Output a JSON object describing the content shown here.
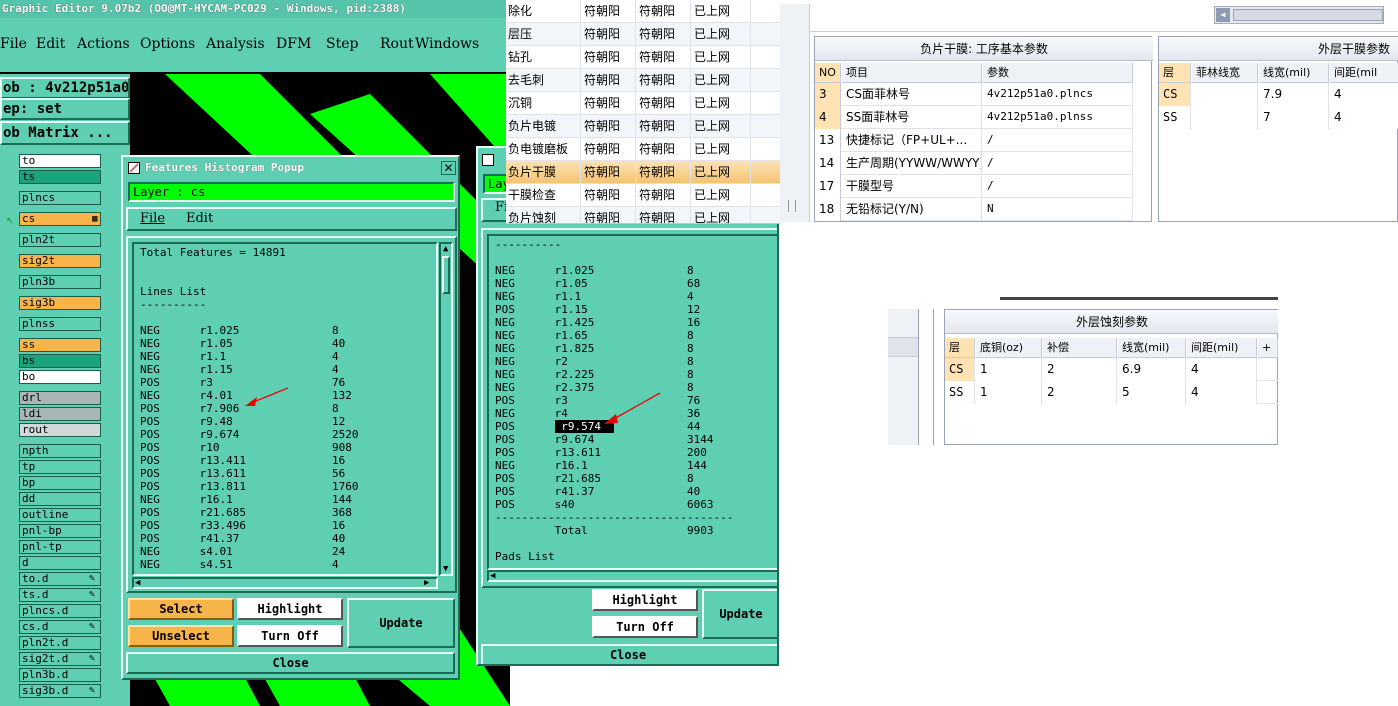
{
  "editor": {
    "title": "Graphic Editor 9.07b2 (OO@MT-HYCAM-PC029 - Windows, pid:2388)",
    "menu": [
      "File",
      "Edit",
      "Actions",
      "Options",
      "Analysis",
      "DFM",
      "Step",
      "Rout",
      "Windows"
    ],
    "job_label": "ob : 4v212p51a0",
    "step_label": "ep: set",
    "matrix_button": "ob Matrix ...",
    "layers": [
      {
        "name": "to",
        "color": "#ffffff"
      },
      {
        "name": "ts",
        "color": "#1aa37f"
      },
      {
        "name": "plncs",
        "color": "#5ecfb3"
      },
      {
        "name": "cs",
        "color": "#f7b44a"
      },
      {
        "name": "pln2t",
        "color": "#5ecfb3"
      },
      {
        "name": "sig2t",
        "color": "#f7b44a"
      },
      {
        "name": "pln3b",
        "color": "#5ecfb3"
      },
      {
        "name": "sig3b",
        "color": "#f7b44a"
      },
      {
        "name": "plnss",
        "color": "#5ecfb3"
      },
      {
        "name": "ss",
        "color": "#f7b44a"
      },
      {
        "name": "bs",
        "color": "#1aa37f"
      },
      {
        "name": "bo",
        "color": "#ffffff"
      },
      {
        "name": "drl",
        "color": "#a9b6b6"
      },
      {
        "name": "ldi",
        "color": "#a9b6b6"
      },
      {
        "name": "rout",
        "color": "#d0d8d8"
      },
      {
        "name": "npth",
        "color": "#5ecfb3"
      },
      {
        "name": "tp",
        "color": "#5ecfb3"
      },
      {
        "name": "bp",
        "color": "#5ecfb3"
      },
      {
        "name": "dd",
        "color": "#5ecfb3"
      },
      {
        "name": "outline",
        "color": "#5ecfb3"
      },
      {
        "name": "pnl-bp",
        "color": "#5ecfb3"
      },
      {
        "name": "pnl-tp",
        "color": "#5ecfb3"
      },
      {
        "name": "d",
        "color": "#5ecfb3"
      },
      {
        "name": "to.d",
        "color": "#5ecfb3"
      },
      {
        "name": "ts.d",
        "color": "#5ecfb3"
      },
      {
        "name": "plncs.d",
        "color": "#5ecfb3"
      },
      {
        "name": "cs.d",
        "color": "#5ecfb3"
      },
      {
        "name": "pln2t.d",
        "color": "#5ecfb3"
      },
      {
        "name": "sig2t.d",
        "color": "#5ecfb3"
      },
      {
        "name": "pln3b.d",
        "color": "#5ecfb3"
      },
      {
        "name": "sig3b.d",
        "color": "#5ecfb3"
      }
    ]
  },
  "popup1": {
    "title": "Features Histogram Popup",
    "layer_label": "Layer :  cs",
    "menu": {
      "file": "File",
      "edit": "Edit"
    },
    "content_lines": [
      "Total Features = 14891",
      "",
      "",
      "Lines List",
      "----------",
      "",
      "NEG      r1.025              8",
      "NEG      r1.05               40",
      "NEG      r1.1                4",
      "NEG      r1.15               4",
      "POS      r3                  76",
      "NEG      r4.01               132",
      "POS      r7.906              8",
      "POS      r9.48               12",
      "POS      r9.674              2520",
      "POS      r10                 908",
      "POS      r13.411             16",
      "POS      r13.611             56",
      "POS      r13.811             1760",
      "NEG      r16.1               144",
      "POS      r21.685             368",
      "POS      r33.496             16",
      "POS      r41.37              40",
      "NEG      s4.01               24",
      "NEG      s4.51               4"
    ],
    "buttons": {
      "select": "Select",
      "unselect": "Unselect",
      "highlight": "Highlight",
      "turnoff": "Turn Off",
      "update": "Update",
      "close": "Close"
    }
  },
  "popup2": {
    "layer_label": "Lay",
    "menu_file": "Fi",
    "content_lines": [
      "----------",
      "",
      "NEG      r1.025              8",
      "NEG      r1.05               68",
      "NEG      r1.1                4",
      "POS      r1.15               12",
      "NEG      r1.425              16",
      "NEG      r1.65               8",
      "NEG      r1.825              8",
      "NEG      r2                  8",
      "NEG      r2.225              8",
      "NEG      r2.375              8",
      "POS      r3                  76",
      "NEG      r4                  36",
      "POS      r9.574              44",
      "POS      r9.674              3144",
      "POS      r13.611             200",
      "NEG      r16.1               144",
      "POS      r21.685             8",
      "POS      r41.37              40",
      "POS      s40                 6063",
      "------------------------------------",
      "         Total               9903",
      "",
      "Pads List"
    ],
    "highlight_value": "r9.574",
    "buttons": {
      "highlight": "Highlight",
      "turnoff": "Turn Off",
      "update": "Update",
      "close": "Close"
    }
  },
  "process_list": {
    "rows": [
      {
        "step": "除化",
        "a": "符朝阳",
        "b": "符朝阳",
        "status": "已上网"
      },
      {
        "step": "层压",
        "a": "符朝阳",
        "b": "符朝阳",
        "status": "已上网"
      },
      {
        "step": "钻孔",
        "a": "符朝阳",
        "b": "符朝阳",
        "status": "已上网"
      },
      {
        "step": "去毛刺",
        "a": "符朝阳",
        "b": "符朝阳",
        "status": "已上网"
      },
      {
        "step": "沉铜",
        "a": "符朝阳",
        "b": "符朝阳",
        "status": "已上网"
      },
      {
        "step": "负片电镀",
        "a": "符朝阳",
        "b": "符朝阳",
        "status": "已上网"
      },
      {
        "step": "负电镀磨板",
        "a": "符朝阳",
        "b": "符朝阳",
        "status": "已上网"
      },
      {
        "step": "负片干膜",
        "a": "符朝阳",
        "b": "符朝阳",
        "status": "已上网"
      },
      {
        "step": "干膜检查",
        "a": "符朝阳",
        "b": "符朝阳",
        "status": "已上网"
      },
      {
        "step": "负片蚀刻",
        "a": "符朝阳",
        "b": "符朝阳",
        "status": "已上网"
      }
    ],
    "selected_index": 7
  },
  "basic_params": {
    "title": "负片干膜: 工序基本参数",
    "headers": [
      "NO",
      "项目",
      "参数"
    ],
    "rows": [
      {
        "no": "3",
        "item": "CS面菲林号",
        "value": "4v212p51a0.plncs"
      },
      {
        "no": "4",
        "item": "SS面菲林号",
        "value": "4v212p51a0.plnss"
      },
      {
        "no": "13",
        "item": "快捷标记（FP+UL+...",
        "value": "/"
      },
      {
        "no": "14",
        "item": "生产周期(YYWW/WWYY)",
        "value": "/"
      },
      {
        "no": "17",
        "item": "干膜型号",
        "value": "/"
      },
      {
        "no": "18",
        "item": "无铅标记(Y/N)",
        "value": "N"
      }
    ]
  },
  "dryfilm_params": {
    "title": "外层干膜参数",
    "headers": [
      "层",
      "菲林线宽",
      "线宽(mil)",
      "间距(mil"
    ],
    "rows": [
      {
        "layer": "CS",
        "film": "",
        "width": "7.9",
        "space": "4"
      },
      {
        "layer": "SS",
        "film": "",
        "width": "7",
        "space": "4"
      }
    ]
  },
  "etch_params": {
    "title": "外层蚀刻参数",
    "headers": [
      "层",
      "底铜(oz)",
      "补偿",
      "线宽(mil)",
      "间距(mil)",
      "+"
    ],
    "rows": [
      {
        "layer": "CS",
        "base": "1",
        "comp": "2",
        "width": "6.9",
        "space": "4"
      },
      {
        "layer": "SS",
        "base": "1",
        "comp": "2",
        "width": "5",
        "space": "4"
      }
    ]
  },
  "icons": [
    "close-icon",
    "popup-app-icon",
    "cursor-arrow-icon",
    "red-arrow-icon",
    "scroll-arrow-icon"
  ]
}
